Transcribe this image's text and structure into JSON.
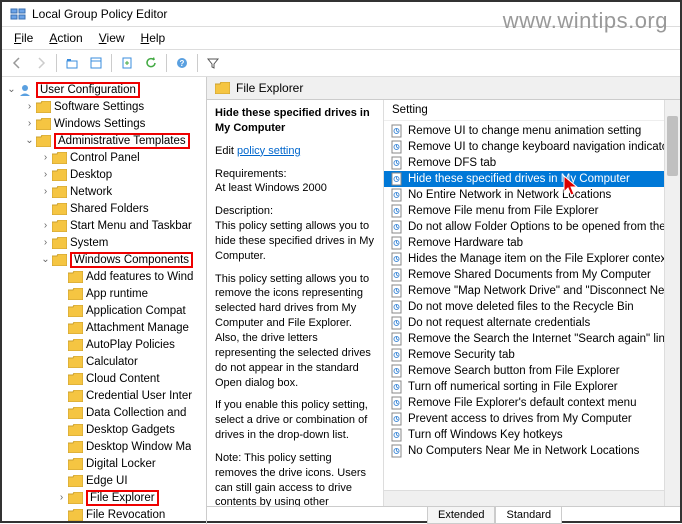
{
  "window": {
    "title": "Local Group Policy Editor"
  },
  "watermark": "www.wintips.org",
  "menu": {
    "file": "File",
    "action": "Action",
    "view": "View",
    "help": "Help"
  },
  "tree": {
    "root": "User Configuration",
    "items": [
      {
        "label": "Software Settings",
        "indent": 1,
        "exp": ">"
      },
      {
        "label": "Windows Settings",
        "indent": 1,
        "exp": ">"
      },
      {
        "label": "Administrative Templates",
        "indent": 1,
        "exp": "v",
        "hl": true
      },
      {
        "label": "Control Panel",
        "indent": 2,
        "exp": ">"
      },
      {
        "label": "Desktop",
        "indent": 2,
        "exp": ">"
      },
      {
        "label": "Network",
        "indent": 2,
        "exp": ">"
      },
      {
        "label": "Shared Folders",
        "indent": 2,
        "exp": ""
      },
      {
        "label": "Start Menu and Taskbar",
        "indent": 2,
        "exp": ">"
      },
      {
        "label": "System",
        "indent": 2,
        "exp": ">"
      },
      {
        "label": "Windows Components",
        "indent": 2,
        "exp": "v",
        "hl": true
      },
      {
        "label": "Add features to Wind",
        "indent": 3,
        "exp": ""
      },
      {
        "label": "App runtime",
        "indent": 3,
        "exp": ""
      },
      {
        "label": "Application Compat",
        "indent": 3,
        "exp": ""
      },
      {
        "label": "Attachment Manage",
        "indent": 3,
        "exp": ""
      },
      {
        "label": "AutoPlay Policies",
        "indent": 3,
        "exp": ""
      },
      {
        "label": "Calculator",
        "indent": 3,
        "exp": ""
      },
      {
        "label": "Cloud Content",
        "indent": 3,
        "exp": ""
      },
      {
        "label": "Credential User Inter",
        "indent": 3,
        "exp": ""
      },
      {
        "label": "Data Collection and",
        "indent": 3,
        "exp": ""
      },
      {
        "label": "Desktop Gadgets",
        "indent": 3,
        "exp": ""
      },
      {
        "label": "Desktop Window Ma",
        "indent": 3,
        "exp": ""
      },
      {
        "label": "Digital Locker",
        "indent": 3,
        "exp": ""
      },
      {
        "label": "Edge UI",
        "indent": 3,
        "exp": ""
      },
      {
        "label": "File Explorer",
        "indent": 3,
        "exp": ">",
        "hl": true
      },
      {
        "label": "File Revocation",
        "indent": 3,
        "exp": ""
      }
    ]
  },
  "header": {
    "title": "File Explorer"
  },
  "detail": {
    "title": "Hide these specified drives in My Computer",
    "edit_prefix": "Edit ",
    "edit_link": "policy setting",
    "req_label": "Requirements:",
    "req_value": "At least Windows 2000",
    "desc_label": "Description:",
    "p1": "This policy setting allows you to hide these specified drives in My Computer.",
    "p2": "This policy setting allows you to remove the icons representing selected hard drives from My Computer and File Explorer. Also, the drive letters representing the selected drives do not appear in the standard Open dialog box.",
    "p3": "If you enable this policy setting, select a drive or combination of drives in the drop-down list.",
    "p4": "Note: This policy setting removes the drive icons. Users can still gain access to drive contents by using other methods, such as by typing"
  },
  "settings": {
    "header": "Setting",
    "items": [
      "Remove UI to change menu animation setting",
      "Remove UI to change keyboard navigation indicato",
      "Remove DFS tab",
      "Hide these specified drives in My Computer",
      "No Entire Network in Network Locations",
      "Remove File menu from File Explorer",
      "Do not allow Folder Options to be opened from the",
      "Remove Hardware tab",
      "Hides the Manage item on the File Explorer contex",
      "Remove Shared Documents from My Computer",
      "Remove \"Map Network Drive\" and \"Disconnect Ne",
      "Do not move deleted files to the Recycle Bin",
      "Do not request alternate credentials",
      "Remove the Search the Internet \"Search again\" link",
      "Remove Security tab",
      "Remove Search button from File Explorer",
      "Turn off numerical sorting in File Explorer",
      "Remove File Explorer's default context menu",
      "Prevent access to drives from My Computer",
      "Turn off Windows Key hotkeys",
      "No Computers Near Me in Network Locations"
    ],
    "selected": 3
  },
  "tabs": {
    "extended": "Extended",
    "standard": "Standard"
  }
}
